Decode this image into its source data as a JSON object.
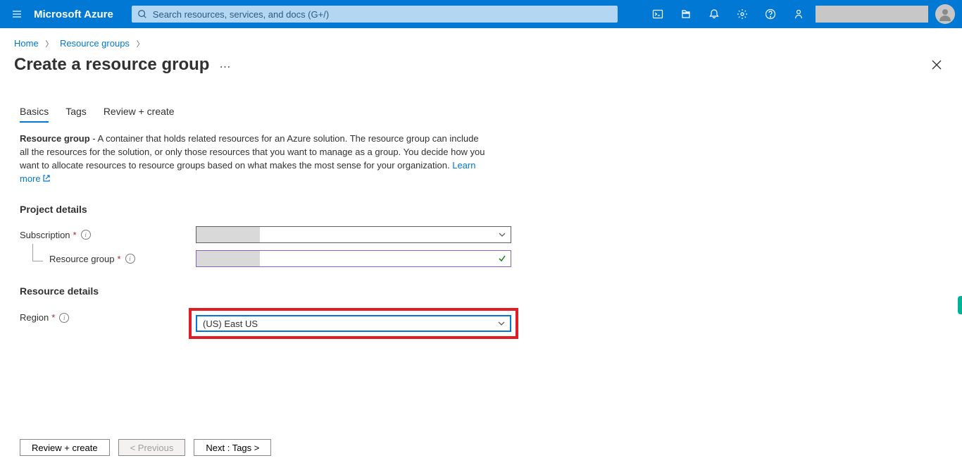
{
  "header": {
    "brand": "Microsoft Azure",
    "search_placeholder": "Search resources, services, and docs (G+/)"
  },
  "breadcrumb": {
    "home": "Home",
    "resource_groups": "Resource groups"
  },
  "page": {
    "title": "Create a resource group"
  },
  "tabs": {
    "basics": "Basics",
    "tags": "Tags",
    "review": "Review + create"
  },
  "desc": {
    "lead": "Resource group",
    "body": " - A container that holds related resources for an Azure solution. The resource group can include all the resources for the solution, or only those resources that you want to manage as a group. You decide how you want to allocate resources to resource groups based on what makes the most sense for your organization. ",
    "learn_more": "Learn more"
  },
  "sections": {
    "project_details": "Project details",
    "resource_details": "Resource details"
  },
  "fields": {
    "subscription_label": "Subscription",
    "resource_group_label": "Resource group",
    "region_label": "Region",
    "region_value": "(US) East US"
  },
  "footer": {
    "review_create": "Review + create",
    "previous": "< Previous",
    "next_tags": "Next : Tags >"
  }
}
